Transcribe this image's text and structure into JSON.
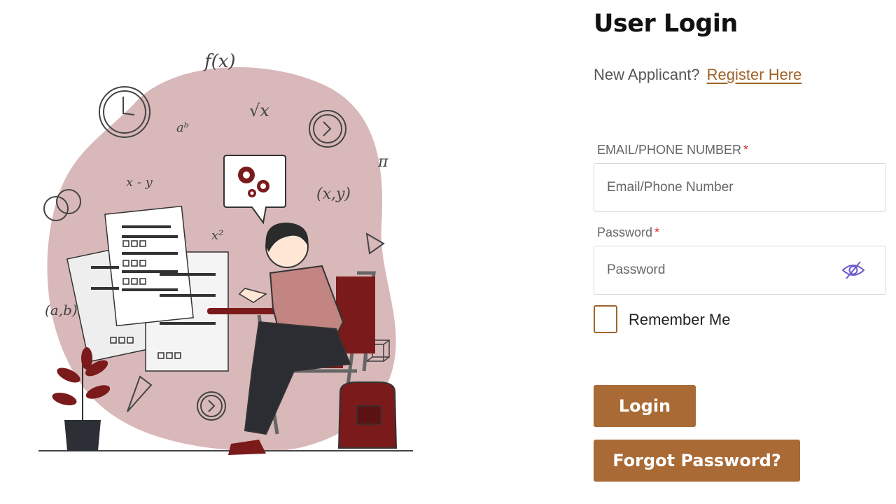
{
  "login": {
    "title": "User Login",
    "new_applicant_text": "New Applicant?",
    "register_link": "Register Here",
    "email_label": "EMAIL/PHONE NUMBER",
    "required_marker": "*",
    "email_placeholder": "Email/Phone Number",
    "password_label": "Password",
    "password_placeholder": "Password",
    "password_visibility_icon": "eye-slash-icon",
    "remember_label": "Remember Me",
    "remember_checked": false,
    "login_button": "Login",
    "forgot_button": "Forgot Password?"
  },
  "illustration": {
    "symbols": [
      "f(x)",
      "aᵇ",
      "√x",
      "π",
      "x - y",
      "(x,y)",
      "x²",
      "(a,b)"
    ]
  },
  "colors": {
    "accent": "#a96a35",
    "link": "#a0632a",
    "required": "#d32f2f",
    "blob": "#d9b8b9",
    "dark_red": "#7a1a1a"
  }
}
